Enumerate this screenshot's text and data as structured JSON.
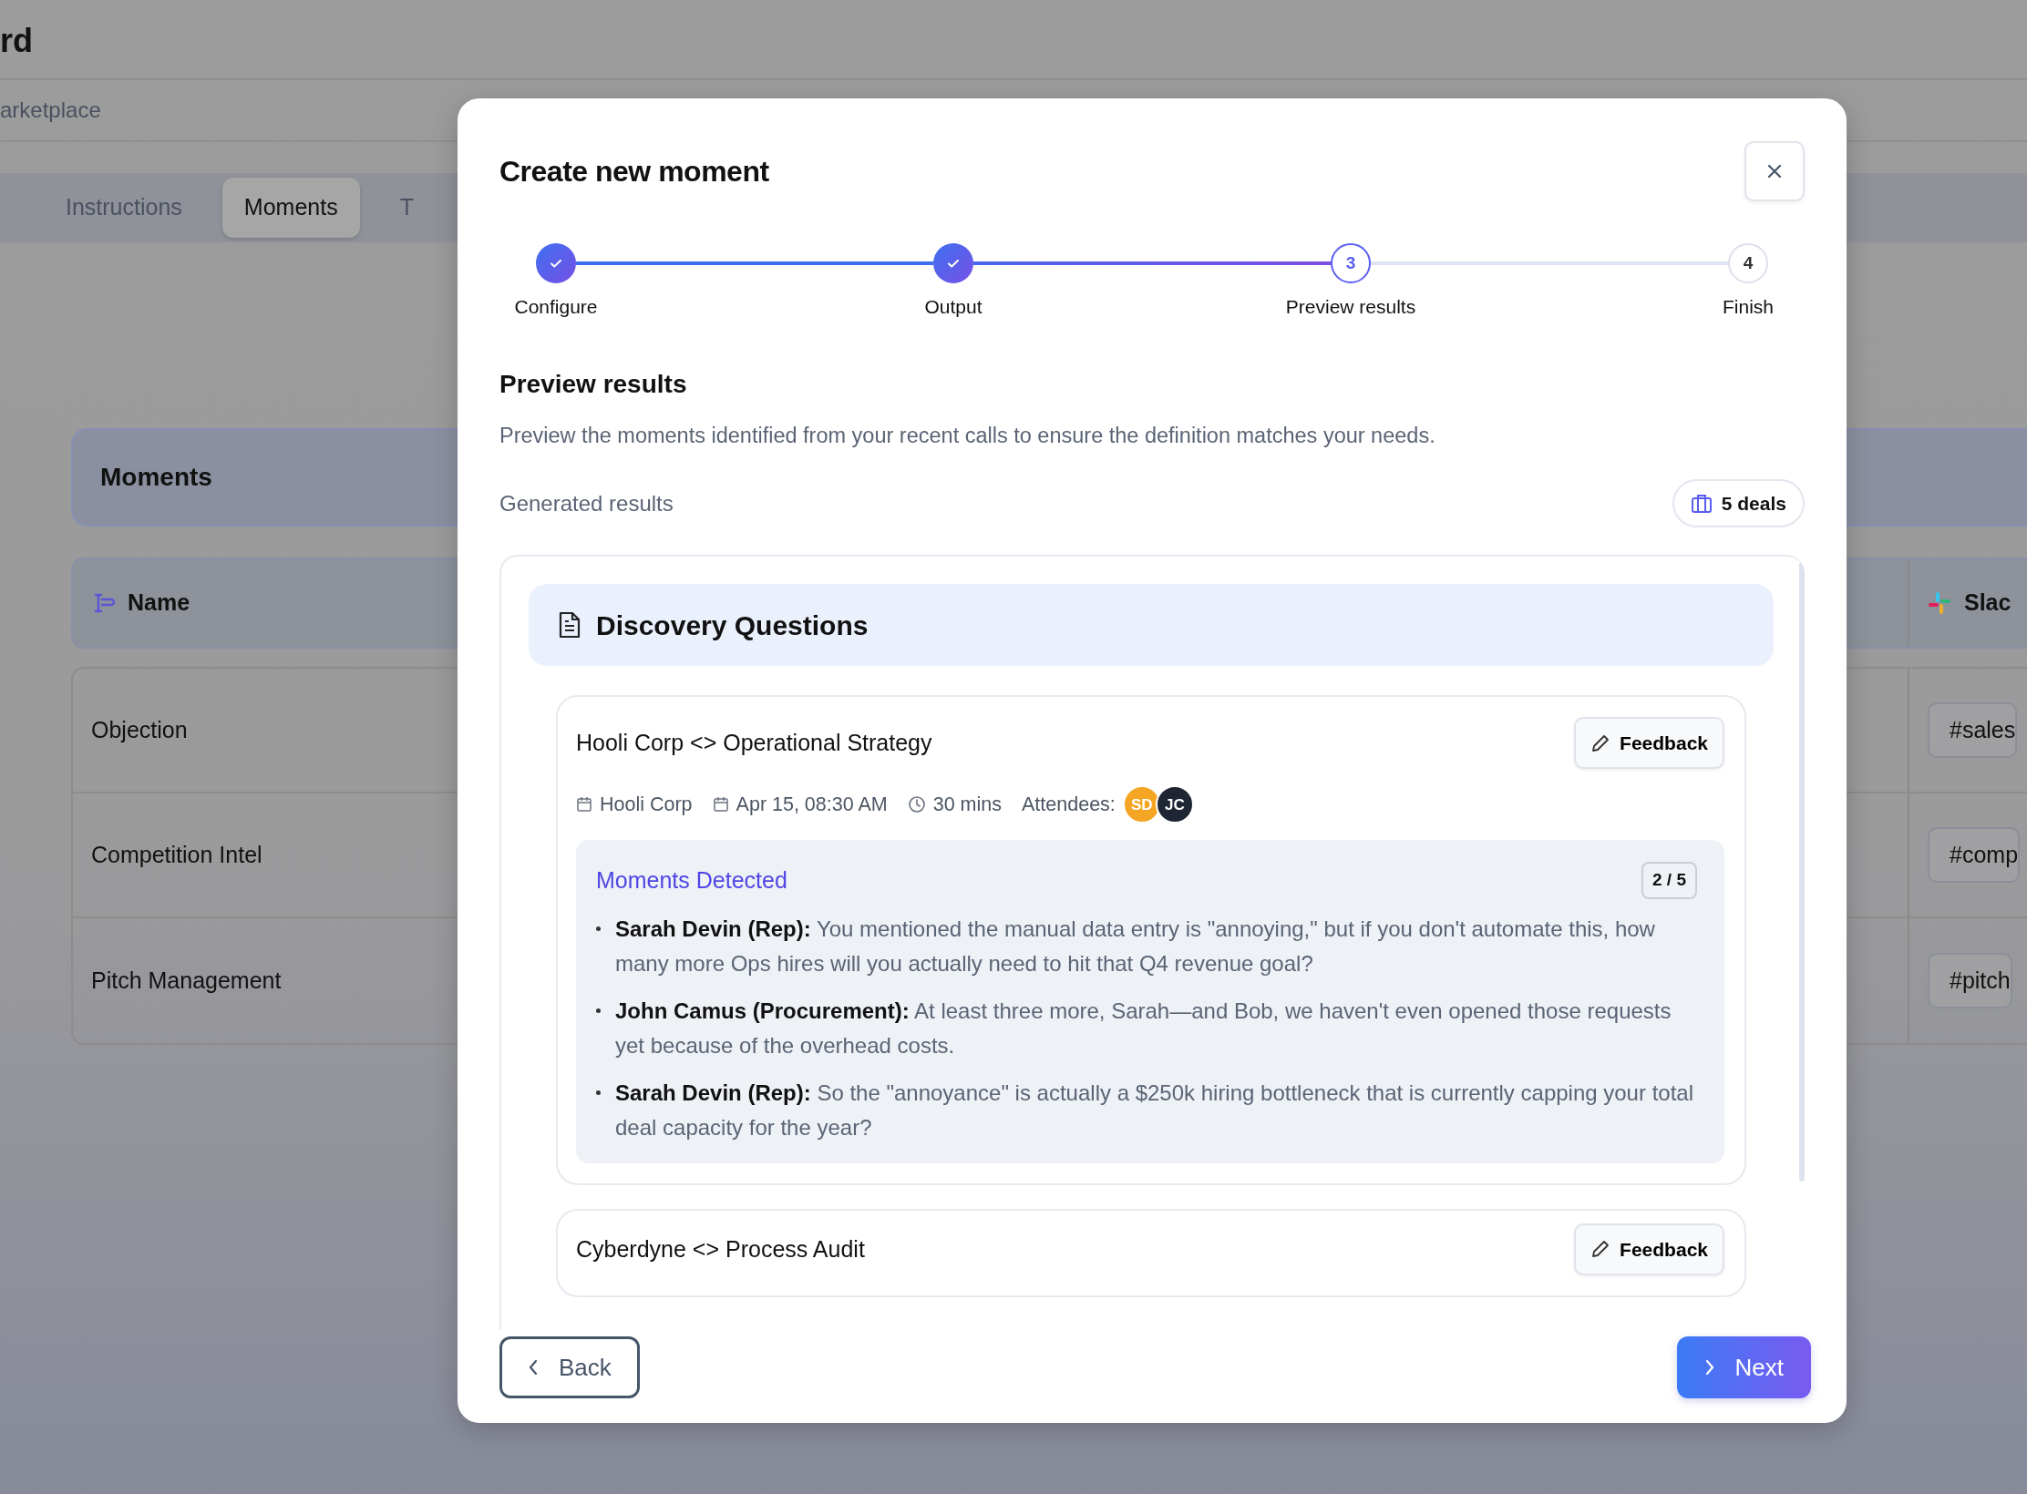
{
  "background": {
    "page_title": "rd",
    "breadcrumb": "arketplace",
    "tabs": [
      {
        "label": "Instructions",
        "selected": false
      },
      {
        "label": "Moments",
        "selected": true
      },
      {
        "label": "T",
        "selected": false
      }
    ],
    "panel_title": "Moments",
    "table": {
      "columns": [
        "Name",
        "Slac"
      ],
      "rows": [
        {
          "name": "Objection",
          "channel": "#sales"
        },
        {
          "name": "Competition Intel",
          "channel": "#comp"
        },
        {
          "name": "Pitch Management",
          "channel": "#pitch"
        }
      ]
    }
  },
  "modal": {
    "title": "Create new moment",
    "steps": [
      {
        "label": "Configure",
        "completed": true,
        "selected": false
      },
      {
        "label": "Output",
        "completed": true,
        "selected": false
      },
      {
        "label": "Preview results",
        "completed": false,
        "selected": true,
        "number": "3"
      },
      {
        "label": "Finish",
        "completed": false,
        "selected": false,
        "number": "4"
      }
    ],
    "section_title": "Preview results",
    "description": "Preview the moments identified from your recent calls to ensure the definition matches your needs.",
    "results_label": "Generated results",
    "deals": "5 deals",
    "group": {
      "title": "Discovery Questions",
      "calls": [
        {
          "title": "Hooli Corp <> Operational Strategy",
          "feedback": "Feedback",
          "company": "Hooli Corp",
          "date": "Apr 15, 08:30 AM",
          "duration": "30 mins",
          "attendees_label": "Attendees:",
          "attendees": [
            {
              "initials": "SD",
              "color": "#f5a524"
            },
            {
              "initials": "JC",
              "color": "#1e2533"
            }
          ],
          "moments": {
            "title": "Moments Detected",
            "count": "2 / 5",
            "quotes": [
              "**Sarah Devin (Rep):** You mentioned the manual data entry is \"annoying,\" but if you don't automate this, how many more Ops hires will you actually need to hit that Q4 revenue goal?",
              "**John Camus (Procurement):** At least three more, Sarah—and Bob, we haven't even opened those requests yet because of the overhead costs.",
              "**Sarah Devin (Rep):** So the \"annoyance\" is actually a $250k hiring bottleneck that is currently capping your total deal capacity for the year?"
            ]
          }
        },
        {
          "title": "Cyberdyne <> Process Audit",
          "feedback": "Feedback"
        }
      ]
    },
    "buttons": {
      "back": "Back",
      "next": "Next"
    }
  }
}
